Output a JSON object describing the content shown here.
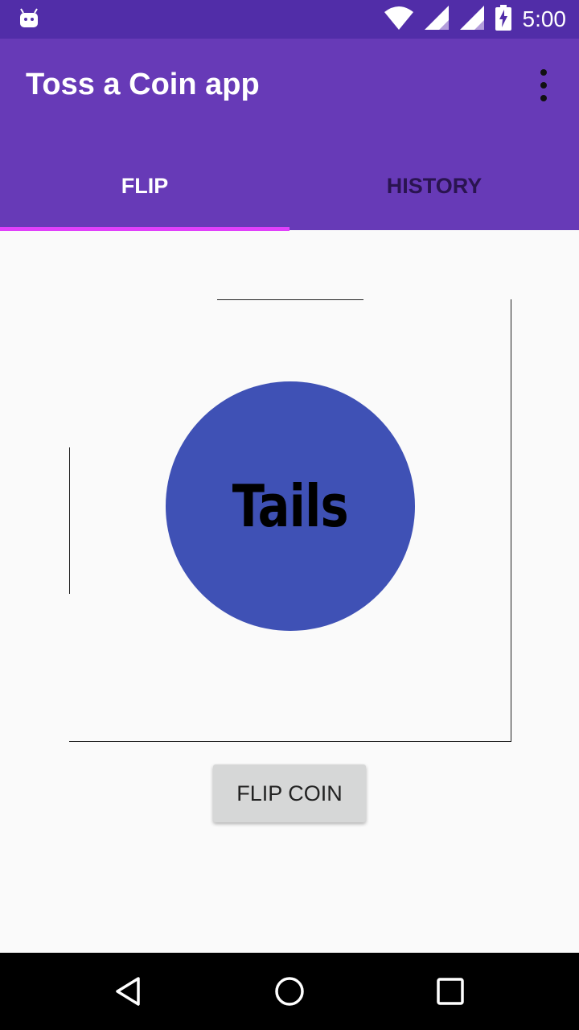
{
  "status_bar": {
    "time": "5:00",
    "icons": [
      "android-debug-icon",
      "wifi-icon",
      "signal-icon",
      "signal-icon",
      "battery-charging-icon"
    ]
  },
  "app_bar": {
    "title": "Toss a Coin app",
    "overflow_icon": "more-vert-icon"
  },
  "tabs": [
    {
      "label": "FLIP",
      "selected": true
    },
    {
      "label": "HISTORY",
      "selected": false
    }
  ],
  "coin": {
    "face": "Tails",
    "color": "#3f51b5"
  },
  "flip_button": {
    "label": "FLIP COIN"
  },
  "nav_bar": {
    "icons": [
      "back-icon",
      "home-icon",
      "recents-icon"
    ]
  },
  "colors": {
    "status_bar": "#512da8",
    "app_bar": "#673ab7",
    "tab_indicator": "#e040fb",
    "background": "#fafafa"
  }
}
